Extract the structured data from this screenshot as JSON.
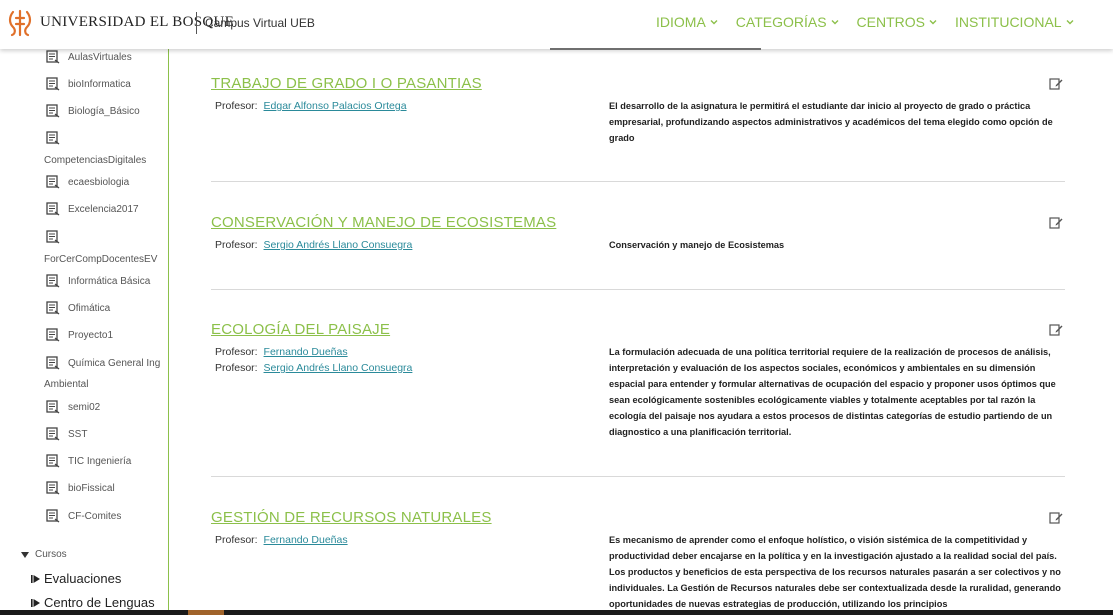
{
  "header": {
    "brand": "UNIVERSIDAD EL BOSQUE",
    "subtitle": "Campus Virtual UEB",
    "nav": [
      "IDIOMA",
      "CATEGORÍAS",
      "CENTROS",
      "INSTITUCIONAL"
    ],
    "accent_color": "#8cc04a"
  },
  "sidebar": {
    "items": [
      {
        "label": "AulasVirtuales"
      },
      {
        "label": "bioInformatica"
      },
      {
        "label": "Biología_Básico"
      },
      {
        "label": "",
        "wrap": "CompetenciasDigitales"
      },
      {
        "label": "ecaesbiologia"
      },
      {
        "label": "Excelencia2017"
      },
      {
        "label": "",
        "wrap": "ForCerCompDocentesEV"
      },
      {
        "label": "Informática Básica"
      },
      {
        "label": "Ofimática"
      },
      {
        "label": "Proyecto1"
      },
      {
        "label": "Química General Ing",
        "wrap": "Ambiental"
      },
      {
        "label": "semi02"
      },
      {
        "label": "SST"
      },
      {
        "label": "TIC Ingeniería"
      },
      {
        "label": "bioFissical"
      },
      {
        "label": "CF-Comites"
      }
    ],
    "section": "Cursos",
    "nodes": [
      "Evaluaciones",
      "Centro de Lenguas"
    ]
  },
  "courses": [
    {
      "title": "TRABAJO DE GRADO I O PASANTIAS",
      "teacher_label": "Profesor:",
      "teachers": [
        "Edgar Alfonso Palacios Ortega"
      ],
      "summary": "El desarrollo de la asignatura le permitirá  el estudiante dar inicio al proyecto de grado o práctica empresarial,  profundizando aspectos administrativos y académicos del tema elegido  como opción de grado"
    },
    {
      "title": "CONSERVACIÓN Y MANEJO DE ECOSISTEMAS",
      "teacher_label": "Profesor:",
      "teachers": [
        "Sergio Andrés Llano Consuegra"
      ],
      "summary": "Conservación y manejo de Ecosistemas"
    },
    {
      "title": "ECOLOGÍA DEL PAISAJE",
      "teacher_label": "Profesor:",
      "teachers": [
        "Fernando Dueñas",
        "Sergio Andrés Llano Consuegra"
      ],
      "summary": "La formulación adecuada de una política territorial requiere de la realización de procesos de análisis, interpretación y evaluación de los aspectos sociales, económicos y ambientales en su dimensión espacial para entender y formular alternativas de ocupación del espacio y proponer usos óptimos que sean ecológicamente sostenibles ecológicamente viables y totalmente aceptables por tal razón la ecología del paisaje nos ayudara a estos procesos de distintas categorías de estudio partiendo de un diagnostico a una planificación territorial."
    },
    {
      "title": "GESTIÓN DE RECURSOS NATURALES",
      "teacher_label": "Profesor:",
      "teachers": [
        "Fernando Dueñas"
      ],
      "summary": "Es  mecanismo de  aprender  como  el enfoque holístico, o visión sistémica de la competitividad y productividad deber encajarse en la  política y en la  investigación  ajustado a la realidad social del país. Los productos y  beneficios  de esta perspectiva de los recursos naturales  pasarán a ser colectivos y no individuales. La Gestión de  Recursos naturales  debe ser  contextualizada desde la ruralidad, generando oportunidades  de nuevas estrategias de producción, utilizando los principios"
    }
  ]
}
